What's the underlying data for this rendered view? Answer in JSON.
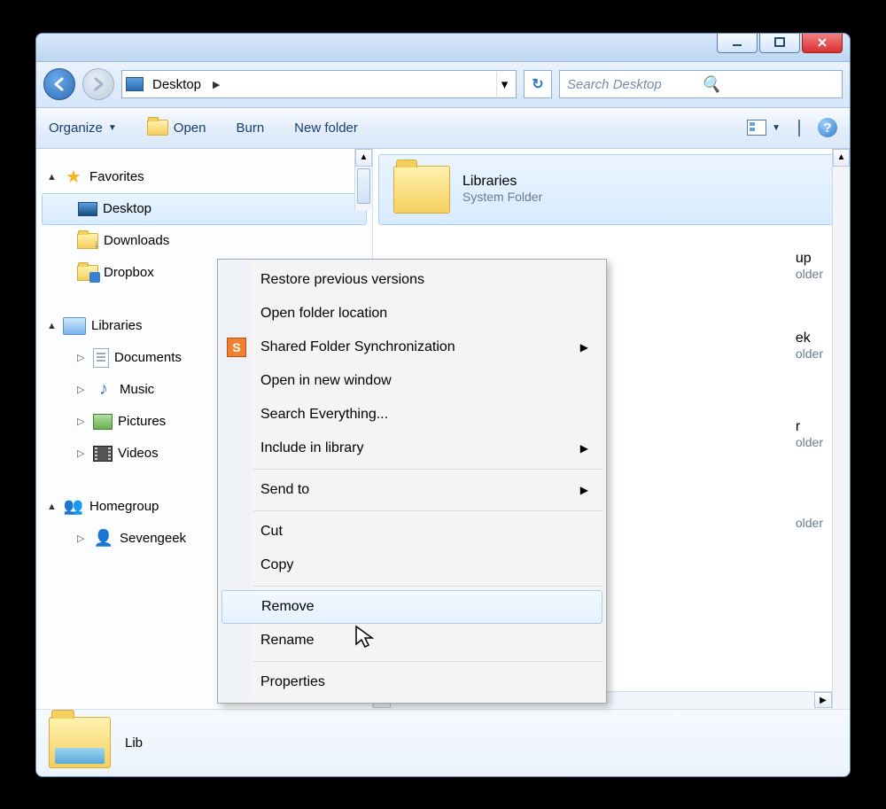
{
  "titlebar": {
    "minimize": "–",
    "maximize": "□",
    "close": "×"
  },
  "nav": {
    "location_label": "Desktop",
    "search_placeholder": "Search Desktop"
  },
  "toolbar": {
    "organize": "Organize",
    "open": "Open",
    "burn": "Burn",
    "new_folder": "New folder"
  },
  "sidebar": {
    "favorites": {
      "label": "Favorites",
      "items": [
        {
          "label": "Desktop",
          "icon": "monitor",
          "selected": true
        },
        {
          "label": "Downloads",
          "icon": "folder-dl"
        },
        {
          "label": "Dropbox",
          "icon": "folder-db"
        }
      ]
    },
    "libraries": {
      "label": "Libraries",
      "items": [
        {
          "label": "Documents",
          "icon": "doc"
        },
        {
          "label": "Music",
          "icon": "music"
        },
        {
          "label": "Pictures",
          "icon": "pic"
        },
        {
          "label": "Videos",
          "icon": "video"
        }
      ]
    },
    "homegroup": {
      "label": "Homegroup",
      "items": [
        {
          "label": "Sevengeek",
          "icon": "person"
        }
      ]
    }
  },
  "main": {
    "items": [
      {
        "name": "Libraries",
        "sub": "System Folder",
        "selected": true
      },
      {
        "name_suffix": "up",
        "sub_suffix": "older"
      },
      {
        "name_suffix": "ek",
        "sub_suffix": "older"
      },
      {
        "name_suffix": "r",
        "sub_suffix": "older"
      },
      {
        "name_suffix": "",
        "sub_suffix": "older"
      }
    ]
  },
  "statusbar": {
    "label_prefix": "Lib"
  },
  "context_menu": {
    "items": [
      {
        "label": "Restore previous versions"
      },
      {
        "label": "Open folder location"
      },
      {
        "label": "Shared Folder Synchronization",
        "submenu": true,
        "icon": "s-box"
      },
      {
        "label": "Open in new window"
      },
      {
        "label": "Search Everything..."
      },
      {
        "label": "Include in library",
        "submenu": true
      },
      {
        "sep": true
      },
      {
        "label": "Send to",
        "submenu": true
      },
      {
        "sep": true
      },
      {
        "label": "Cut"
      },
      {
        "label": "Copy"
      },
      {
        "sep": true
      },
      {
        "label": "Remove",
        "hover": true
      },
      {
        "label": "Rename"
      },
      {
        "sep": true
      },
      {
        "label": "Properties"
      }
    ]
  }
}
